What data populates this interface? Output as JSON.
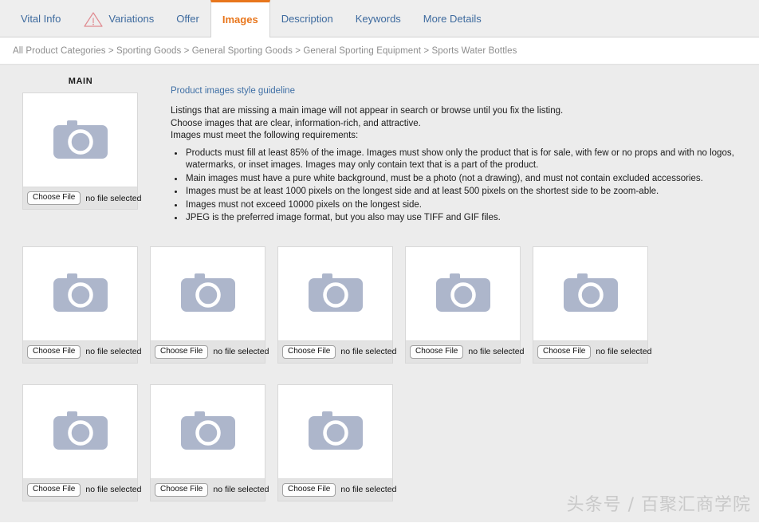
{
  "tabs": [
    {
      "label": "Vital Info",
      "icon": null,
      "active": false
    },
    {
      "label": "Variations",
      "icon": "warning-triangle-icon",
      "active": false
    },
    {
      "label": "Offer",
      "icon": null,
      "active": false
    },
    {
      "label": "Images",
      "icon": null,
      "active": true
    },
    {
      "label": "Description",
      "icon": null,
      "active": false
    },
    {
      "label": "Keywords",
      "icon": null,
      "active": false
    },
    {
      "label": "More Details",
      "icon": null,
      "active": false
    }
  ],
  "breadcrumb": {
    "text": "All Product Categories > Sporting Goods > General Sporting Goods > General Sporting Equipment > Sports Water Bottles",
    "segments": [
      "All Product Categories",
      "Sporting Goods",
      "General Sporting Goods",
      "General Sporting Equipment",
      "Sports Water Bottles"
    ],
    "separator": ">"
  },
  "main_image": {
    "label": "MAIN",
    "choose_button": "Choose File",
    "file_status": "no file selected",
    "placeholder_icon": "camera-icon"
  },
  "guidelines": {
    "link": "Product images style guideline",
    "intro": [
      "Listings that are missing a main image will not appear in search or browse until you fix the listing.",
      "Choose images that are clear, information-rich, and attractive.",
      "Images must meet the following requirements:"
    ],
    "requirements": [
      "Products must fill at least 85% of the image. Images must show only the product that is for sale, with few or no props and with no logos, watermarks, or inset images. Images may only contain text that is a part of the product.",
      "Main images must have a pure white background, must be a photo (not a drawing), and must not contain excluded accessories.",
      "Images must be at least 1000 pixels on the longest side and at least 500 pixels on the shortest side to be zoom-able.",
      "Images must not exceed 10000 pixels on the longest side.",
      "JPEG is the preferred image format, but you also may use TIFF and GIF files."
    ]
  },
  "thumbnail_rows": [
    {
      "tiles": [
        {
          "choose_button": "Choose File",
          "file_status": "no file selected",
          "placeholder_icon": "camera-icon"
        },
        {
          "choose_button": "Choose File",
          "file_status": "no file selected",
          "placeholder_icon": "camera-icon"
        },
        {
          "choose_button": "Choose File",
          "file_status": "no file selected",
          "placeholder_icon": "camera-icon"
        },
        {
          "choose_button": "Choose File",
          "file_status": "no file selected",
          "placeholder_icon": "camera-icon"
        },
        {
          "choose_button": "Choose File",
          "file_status": "no file selected",
          "placeholder_icon": "camera-icon"
        }
      ]
    },
    {
      "tiles": [
        {
          "choose_button": "Choose File",
          "file_status": "no file selected",
          "placeholder_icon": "camera-icon"
        },
        {
          "choose_button": "Choose File",
          "file_status": "no file selected",
          "placeholder_icon": "camera-icon"
        },
        {
          "choose_button": "Choose File",
          "file_status": "no file selected",
          "placeholder_icon": "camera-icon"
        }
      ]
    }
  ],
  "watermark": "头条号 / 百聚汇商学院",
  "colors": {
    "accent_orange": "#e8761c",
    "link_blue": "#3f6fa5",
    "tab_text_blue": "#3d6a9e",
    "warning_red": "#e08a90",
    "camera_gray": "#adb6cb",
    "tab_bar_bg": "#eeeeee",
    "content_bg": "#ececec",
    "tile_foot_bg": "#e3e3e3"
  }
}
